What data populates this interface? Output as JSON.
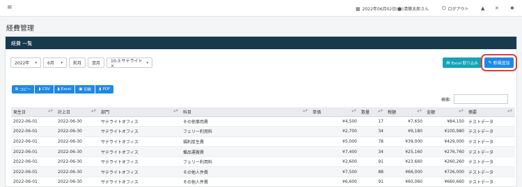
{
  "topbar": {
    "menu_icon": "hamburger-icon",
    "date": "2022年06月02日(木)",
    "user": "清築太郎さん",
    "logout": "ログアウト",
    "icons": [
      "bell-icon",
      "expand-icon",
      "settings-icon"
    ]
  },
  "page_title": "経費管理",
  "panel_title": "経費 一覧",
  "filters": {
    "year": "2022年",
    "month": "6月",
    "prev": "前月",
    "next": "翌月",
    "office": "10-3:サテライト×"
  },
  "actions": {
    "excel_import": "Excel 取り込み",
    "new_add": "新規追加"
  },
  "export_buttons": [
    "コピー",
    "CSV",
    "Excel",
    "印刷",
    "PDF"
  ],
  "search": {
    "label": "検索:"
  },
  "table": {
    "headers": [
      "発生日",
      "計上日",
      "部門",
      "科目",
      "単価",
      "数量",
      "税額",
      "金額",
      "摘要"
    ],
    "rows": [
      [
        "2022-06-01",
        "2022-06-30",
        "サテライトオフィス",
        "その他事両費",
        "¥4,500",
        "17",
        "¥7,650",
        "¥84,150",
        "テストデータ"
      ],
      [
        "2022-06-01",
        "2022-06-30",
        "サテライトオフィス",
        "フェリー利用料",
        "¥2,700",
        "34",
        "¥9,180",
        "¥100,980",
        "テストデータ"
      ],
      [
        "2022-06-01",
        "2022-06-30",
        "サテライトオフィス",
        "福利厚生費",
        "¥5,000",
        "78",
        "¥39,000",
        "¥429,000",
        "テストデータ"
      ],
      [
        "2022-06-01",
        "2022-06-30",
        "サテライトオフィス",
        "備品運搬費",
        "¥7,400",
        "34",
        "¥25,160",
        "¥276,760",
        "テストデータ"
      ],
      [
        "2022-06-01",
        "2022-06-30",
        "サテライトオフィス",
        "フェリー利用料",
        "¥2,600",
        "91",
        "¥23,660",
        "¥260,260",
        "テストデータ"
      ],
      [
        "2022-06-01",
        "2022-06-30",
        "サテライトオフィス",
        "その他人件費",
        "¥7,500",
        "88",
        "¥66,000",
        "¥726,000",
        "テストデータ"
      ],
      [
        "2022-06-01",
        "2022-06-30",
        "サテライトオフィス",
        "その他人件費",
        "¥6,600",
        "91",
        "¥60,060",
        "¥660,660",
        "テストデータ"
      ]
    ]
  }
}
